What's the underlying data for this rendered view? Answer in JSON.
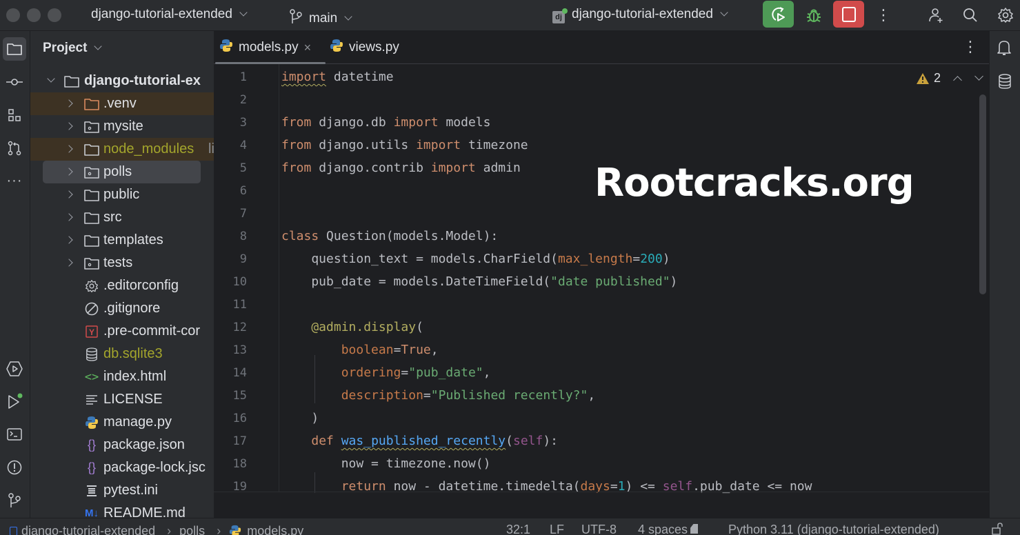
{
  "titlebar": {
    "project_name": "django-tutorial-extended",
    "branch": "main",
    "run_config": "django-tutorial-extended",
    "run_button": "rerun-icon",
    "debug_button": "bug-icon",
    "stop_button": "stop-icon",
    "colors": {
      "run": "#4e9a56",
      "stop": "#d14b4b",
      "debug": "#5fb85f"
    }
  },
  "left_strip": {
    "items": [
      "folder-icon",
      "commit-icon",
      "structure-icon",
      "pull-requests-icon",
      "more-icon",
      "services-icon",
      "run-icon",
      "terminal-icon",
      "problems-icon",
      "git-icon"
    ]
  },
  "project": {
    "title": "Project",
    "root": "django-tutorial-ex",
    "items": [
      {
        "label": ".venv",
        "type": "folder-excluded",
        "expandable": true
      },
      {
        "label": "mysite",
        "type": "package",
        "expandable": true
      },
      {
        "label": "node_modules",
        "suffix": "li",
        "type": "folder-library",
        "expandable": true
      },
      {
        "label": "polls",
        "type": "package",
        "expandable": true,
        "selected": true
      },
      {
        "label": "public",
        "type": "folder",
        "expandable": true
      },
      {
        "label": "src",
        "type": "folder",
        "expandable": true
      },
      {
        "label": "templates",
        "type": "folder",
        "expandable": true
      },
      {
        "label": "tests",
        "type": "package",
        "expandable": true
      },
      {
        "label": ".editorconfig",
        "type": "gear"
      },
      {
        "label": ".gitignore",
        "type": "ignore"
      },
      {
        "label": ".pre-commit-cor",
        "type": "yaml"
      },
      {
        "label": "db.sqlite3",
        "type": "database"
      },
      {
        "label": "index.html",
        "type": "html"
      },
      {
        "label": "LICENSE",
        "type": "text"
      },
      {
        "label": "manage.py",
        "type": "python"
      },
      {
        "label": "package.json",
        "type": "json"
      },
      {
        "label": "package-lock.jsc",
        "type": "json"
      },
      {
        "label": "pytest.ini",
        "type": "ini"
      },
      {
        "label": "README.md",
        "type": "markdown"
      }
    ]
  },
  "editor": {
    "tabs": [
      {
        "label": "models.py",
        "active": true,
        "closable": true
      },
      {
        "label": "views.py",
        "active": false
      }
    ],
    "warnings_count": "2",
    "lines": [
      {
        "n": "1",
        "tokens": [
          [
            "kw warn-ul",
            "import"
          ],
          [
            "",
            " datetime"
          ]
        ]
      },
      {
        "n": "2",
        "tokens": []
      },
      {
        "n": "3",
        "tokens": [
          [
            "kw",
            "from"
          ],
          [
            "",
            " django.db "
          ],
          [
            "kw",
            "import"
          ],
          [
            "",
            " models"
          ]
        ]
      },
      {
        "n": "4",
        "tokens": [
          [
            "kw",
            "from"
          ],
          [
            "",
            " django.utils "
          ],
          [
            "kw",
            "import"
          ],
          [
            "",
            " timezone"
          ]
        ]
      },
      {
        "n": "5",
        "tokens": [
          [
            "kw",
            "from"
          ],
          [
            "",
            " django.contrib "
          ],
          [
            "kw",
            "import"
          ],
          [
            "",
            " admin"
          ]
        ]
      },
      {
        "n": "6",
        "tokens": []
      },
      {
        "n": "7",
        "tokens": []
      },
      {
        "n": "8",
        "tokens": [
          [
            "kw",
            "class"
          ],
          [
            "",
            " Question(models.Model):"
          ]
        ]
      },
      {
        "n": "9",
        "tokens": [
          [
            "",
            "    question_text = models.CharField("
          ],
          [
            "param",
            "max_length"
          ],
          [
            "",
            "="
          ],
          [
            "num",
            "200"
          ],
          [
            "",
            ")"
          ]
        ]
      },
      {
        "n": "10",
        "tokens": [
          [
            "",
            "    pub_date = models.DateTimeField("
          ],
          [
            "str",
            "\"date published\""
          ],
          [
            "",
            ")"
          ]
        ]
      },
      {
        "n": "11",
        "tokens": []
      },
      {
        "n": "12",
        "tokens": [
          [
            "deco",
            "    @admin.display"
          ],
          [
            "",
            "("
          ]
        ]
      },
      {
        "n": "13",
        "tokens": [
          [
            "",
            "        "
          ],
          [
            "param",
            "boolean"
          ],
          [
            "",
            "="
          ],
          [
            "kw",
            "True"
          ],
          [
            "",
            ","
          ]
        ]
      },
      {
        "n": "14",
        "tokens": [
          [
            "",
            "        "
          ],
          [
            "param",
            "ordering"
          ],
          [
            "",
            "="
          ],
          [
            "str",
            "\"pub_date\""
          ],
          [
            "",
            ","
          ]
        ]
      },
      {
        "n": "15",
        "tokens": [
          [
            "",
            "        "
          ],
          [
            "param",
            "description"
          ],
          [
            "",
            "="
          ],
          [
            "str",
            "\"Published recently?\""
          ],
          [
            "",
            ","
          ]
        ]
      },
      {
        "n": "16",
        "tokens": [
          [
            "",
            "    )"
          ]
        ]
      },
      {
        "n": "17",
        "tokens": [
          [
            "",
            "    "
          ],
          [
            "kw",
            "def"
          ],
          [
            "",
            " "
          ],
          [
            "fn",
            "was_published_recently"
          ],
          [
            "",
            "("
          ],
          [
            "self",
            "self"
          ],
          [
            "",
            "):"
          ]
        ]
      },
      {
        "n": "18",
        "tokens": [
          [
            "",
            "        now = timezone.now()"
          ]
        ]
      },
      {
        "n": "19",
        "tokens": [
          [
            "",
            "        "
          ],
          [
            "kw",
            "return"
          ],
          [
            "",
            " now - datetime.timedelta("
          ],
          [
            "param",
            "days"
          ],
          [
            "",
            "="
          ],
          [
            "num",
            "1"
          ],
          [
            "",
            ") <= "
          ],
          [
            "self",
            "self"
          ],
          [
            "",
            ".pub_date <= now"
          ]
        ]
      }
    ]
  },
  "watermark": "Rootcracks.org",
  "right_strip": {
    "items": [
      "notifications-icon",
      "database-icon"
    ]
  },
  "statusbar": {
    "breadcrumb": [
      "django-tutorial-extended",
      "polls",
      "models.py"
    ],
    "position": "32:1",
    "line_ending": "LF",
    "encoding": "UTF-8",
    "indent": "4 spaces",
    "interpreter": "Python 3.11 (django-tutorial-extended)"
  }
}
